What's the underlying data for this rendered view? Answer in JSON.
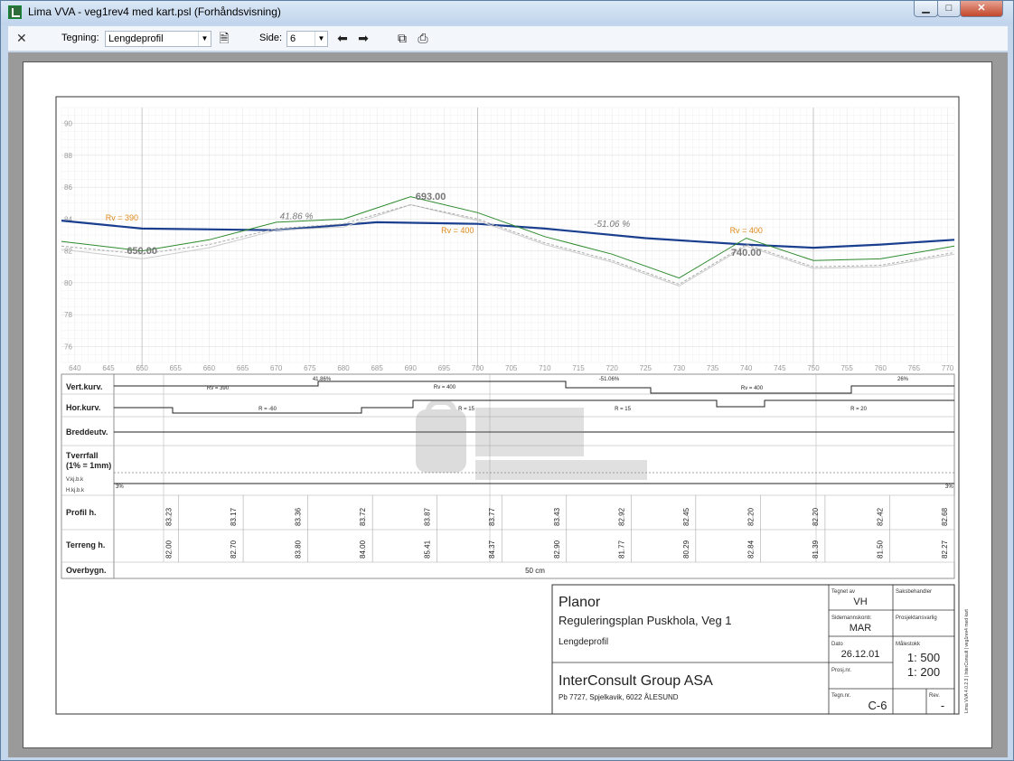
{
  "window": {
    "title": "Lima VVA - veg1rev4 med kart.psl (Forhåndsvisning)",
    "min_label": "▁",
    "max_label": "□",
    "close_label": "✕"
  },
  "toolbar": {
    "close_label": "✕",
    "drawing_label": "Tegning:",
    "drawing_value": "Lengdeprofil",
    "page_label": "Side:",
    "page_value": "6",
    "prev_label": "⬅",
    "next_label": "➡"
  },
  "chart_data": {
    "type": "line",
    "y_ticks": [
      "90",
      "88",
      "86",
      "84",
      "82",
      "80",
      "78",
      "76"
    ],
    "ylim": [
      75,
      91
    ],
    "x_ticks": [
      "640",
      "645",
      "650",
      "655",
      "660",
      "665",
      "670",
      "675",
      "680",
      "685",
      "690",
      "695",
      "700",
      "705",
      "710",
      "715",
      "720",
      "725",
      "730",
      "735",
      "740",
      "745",
      "750",
      "755",
      "760",
      "765",
      "770"
    ],
    "xlim": [
      638,
      771
    ],
    "series": [
      {
        "points": [
          [
            638,
            83.9
          ],
          [
            650,
            83.4
          ],
          [
            670,
            83.3
          ],
          [
            685,
            83.8
          ],
          [
            700,
            83.7
          ],
          [
            710,
            83.4
          ],
          [
            725,
            82.8
          ],
          [
            740,
            82.4
          ],
          [
            750,
            82.2
          ],
          [
            760,
            82.4
          ],
          [
            771,
            82.7
          ]
        ],
        "color": "#1a3f8f"
      },
      {
        "points": [
          [
            638,
            82.6
          ],
          [
            650,
            82.0
          ],
          [
            660,
            82.7
          ],
          [
            670,
            83.8
          ],
          [
            680,
            84.0
          ],
          [
            690,
            85.4
          ],
          [
            700,
            84.4
          ],
          [
            710,
            82.9
          ],
          [
            720,
            81.8
          ],
          [
            730,
            80.3
          ],
          [
            740,
            82.8
          ],
          [
            750,
            81.4
          ],
          [
            760,
            81.5
          ],
          [
            771,
            82.3
          ]
        ],
        "color": "#2e8b2e"
      },
      {
        "points": [
          [
            638,
            82.3
          ],
          [
            650,
            81.8
          ],
          [
            660,
            82.4
          ],
          [
            670,
            83.4
          ],
          [
            680,
            83.7
          ],
          [
            690,
            84.9
          ],
          [
            700,
            84.0
          ],
          [
            710,
            82.5
          ],
          [
            720,
            81.4
          ],
          [
            730,
            79.9
          ],
          [
            740,
            82.4
          ],
          [
            750,
            81.0
          ],
          [
            760,
            81.1
          ],
          [
            771,
            81.9
          ]
        ],
        "color": "#aaaaaa"
      }
    ],
    "annotations": [
      "Rv = 390",
      "650.00",
      "41.86 %",
      "693.00",
      "Rv = 400",
      "-51.06 %",
      "Rv = 400",
      "740.00"
    ]
  },
  "bands": {
    "vert_kurv": "Vert.kurv.",
    "hor_kurv": "Hor.kurv.",
    "breddeutv": "Breddeutv.",
    "tverrfall": "Tverrfall",
    "tverrfall_note": "(1% = 1mm)",
    "v_kj": "V.kj.b.k",
    "h_kj": "H.kj.b.k",
    "profil": "Profil h.",
    "terreng": "Terreng h.",
    "overbygn": "Overbygn.",
    "overbygn_value": "50 cm",
    "vert_labels": [
      "Rv = 390",
      "41.86%",
      "Rv = 400",
      "-51.06%",
      "Rv = 400",
      "26%"
    ],
    "hor_labels": [
      "R = -60",
      "R = 15",
      "R = 15",
      "R = 20"
    ],
    "tverrfall_left": "3%",
    "tverrfall_right": "3%",
    "profil_values": [
      "83.23",
      "83.17",
      "83.36",
      "83.72",
      "83.87",
      "83.77",
      "83.43",
      "82.92",
      "82.45",
      "82.20",
      "82.20",
      "82.42",
      "82.68"
    ],
    "terreng_values": [
      "82.00",
      "82.70",
      "83.80",
      "84.00",
      "85.41",
      "84.37",
      "82.90",
      "81.77",
      "80.29",
      "82.84",
      "81.39",
      "81.50",
      "82.27"
    ]
  },
  "titleblock": {
    "company": "Planor",
    "project": "Reguleringsplan Puskhola,  Veg 1",
    "drawing": "Lengdeprofil",
    "consultant": "InterConsult Group ASA",
    "address": "Pb 7727, Spjelkavik, 6022 ÅLESUND",
    "tegnet_label": "Tegnet av",
    "tegnet_value": "VH",
    "saksbehandler_label": "Saksbehandler",
    "sidemanns_label": "Sidemannskontr.",
    "sidemanns_value": "MAR",
    "prosjektansvarlig_label": "Prosjektansvarlig",
    "dato_label": "Dato",
    "dato_value": "26.12.01",
    "malestokk_label": "Målestokk",
    "malestokk_1": "1: 500",
    "malestokk_2": "1: 200",
    "prosj_label": "Prosj.nr.",
    "tegn_label": "Tegn.nr.",
    "tegn_value": "C-6",
    "rev_label": "Rev.",
    "rev_value": "-",
    "side_note": "Lima VVA 4.0.2.3 | InterConsult | veg1rev4 med kart"
  }
}
